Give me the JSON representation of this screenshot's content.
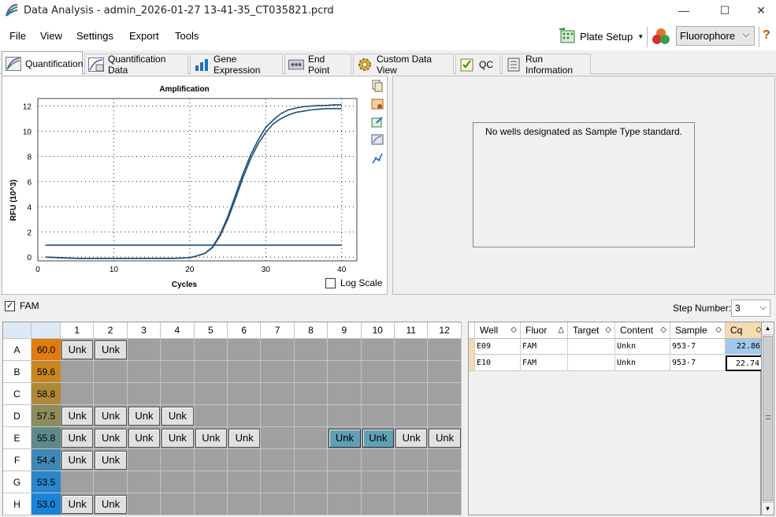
{
  "window": {
    "title": "Data Analysis - admin_2026-01-27 13-41-35_CT035821.pcrd",
    "minimize": "—",
    "maximize": "☐",
    "close": "✕"
  },
  "menu": {
    "file": "File",
    "view": "View",
    "settings": "Settings",
    "export": "Export",
    "tools": "Tools",
    "plate_setup": "Plate Setup",
    "fluorophore": "Fluorophore",
    "help": "?"
  },
  "tabs": [
    "Quantification",
    "Quantification Data",
    "Gene Expression",
    "End Point",
    "Custom Data View",
    "QC",
    "Run Information"
  ],
  "chart": {
    "title": "Amplification",
    "xlabel": "Cycles",
    "ylabel": "RFU (10^3)",
    "log_scale_label": "Log Scale"
  },
  "chart_data": {
    "type": "line",
    "title": "Amplification",
    "xlabel": "Cycles",
    "ylabel": "RFU (10^3)",
    "xlim": [
      0,
      42
    ],
    "ylim": [
      -0.3,
      12.6
    ],
    "xticks": [
      0,
      10,
      20,
      30,
      40
    ],
    "yticks": [
      0,
      2,
      4,
      6,
      8,
      10,
      12
    ],
    "grid": true,
    "series": [
      {
        "color": "#1f4e79",
        "x": [
          1,
          5,
          10,
          15,
          18,
          20,
          21,
          22,
          23,
          24,
          25,
          26,
          27,
          28,
          29,
          30,
          31,
          32,
          33,
          34,
          35,
          36,
          37,
          38,
          39,
          40
        ],
        "y": [
          0.0,
          -0.1,
          -0.1,
          -0.1,
          -0.1,
          -0.05,
          0.1,
          0.3,
          0.8,
          1.8,
          3.2,
          4.9,
          6.6,
          8.1,
          9.3,
          10.3,
          10.9,
          11.4,
          11.7,
          11.85,
          11.95,
          12.0,
          12.05,
          12.05,
          12.1,
          12.1
        ]
      },
      {
        "color": "#1f4e79",
        "x": [
          1,
          5,
          10,
          15,
          18,
          20,
          21,
          22,
          23,
          24,
          25,
          26,
          27,
          28,
          29,
          30,
          31,
          32,
          33,
          34,
          35,
          36,
          37,
          38,
          39,
          40
        ],
        "y": [
          0.0,
          -0.1,
          -0.1,
          -0.1,
          -0.1,
          -0.05,
          0.1,
          0.3,
          0.75,
          1.7,
          3.0,
          4.6,
          6.3,
          7.8,
          9.0,
          9.9,
          10.6,
          11.0,
          11.3,
          11.5,
          11.6,
          11.7,
          11.75,
          11.8,
          11.8,
          11.8
        ]
      },
      {
        "color": "#1f4e79",
        "x": [
          1,
          40
        ],
        "y": [
          0.95,
          0.95
        ]
      }
    ]
  },
  "standard_panel": {
    "message": "No wells designated as Sample Type standard."
  },
  "fluor_filter": {
    "label": "FAM",
    "checked": true
  },
  "step": {
    "label": "Step Number:",
    "value": "3"
  },
  "plate": {
    "columns": [
      "1",
      "2",
      "3",
      "4",
      "5",
      "6",
      "7",
      "8",
      "9",
      "10",
      "11",
      "12"
    ],
    "rows": [
      {
        "label": "A",
        "temp": "60.0",
        "temp_color": "#e07b10",
        "wells": [
          "Unk",
          "Unk",
          "",
          "",
          "",
          "",
          "",
          "",
          "",
          "",
          "",
          ""
        ]
      },
      {
        "label": "B",
        "temp": "59.6",
        "temp_color": "#c8861f",
        "wells": [
          "",
          "",
          "",
          "",
          "",
          "",
          "",
          "",
          "",
          "",
          "",
          ""
        ]
      },
      {
        "label": "C",
        "temp": "58.8",
        "temp_color": "#b0883a",
        "wells": [
          "",
          "",
          "",
          "",
          "",
          "",
          "",
          "",
          "",
          "",
          "",
          ""
        ]
      },
      {
        "label": "D",
        "temp": "57.5",
        "temp_color": "#8c8c5e",
        "wells": [
          "Unk",
          "Unk",
          "Unk",
          "Unk",
          "",
          "",
          "",
          "",
          "",
          "",
          "",
          ""
        ]
      },
      {
        "label": "E",
        "temp": "55.8",
        "temp_color": "#5f8a8a",
        "wells": [
          "Unk",
          "Unk",
          "Unk",
          "Unk",
          "Unk",
          "Unk",
          "",
          "",
          "Unk",
          "Unk",
          "Unk",
          "Unk"
        ]
      },
      {
        "label": "F",
        "temp": "54.4",
        "temp_color": "#3f88b6",
        "wells": [
          "Unk",
          "Unk",
          "",
          "",
          "",
          "",
          "",
          "",
          "",
          "",
          "",
          ""
        ]
      },
      {
        "label": "G",
        "temp": "53.5",
        "temp_color": "#2a86cc",
        "wells": [
          "",
          "",
          "",
          "",
          "",
          "",
          "",
          "",
          "",
          "",
          "",
          ""
        ]
      },
      {
        "label": "H",
        "temp": "53.0",
        "temp_color": "#1a82d8",
        "wells": [
          "Unk",
          "Unk",
          "",
          "",
          "",
          "",
          "",
          "",
          "",
          "",
          "",
          ""
        ]
      }
    ],
    "selected_wells": [
      "E9",
      "E10"
    ]
  },
  "results": {
    "headers": [
      "Well",
      "Fluor",
      "Target",
      "Content",
      "Sample",
      "Cq"
    ],
    "rows": [
      {
        "well": "E09",
        "fluor": "FAM",
        "target": "",
        "content": "Unkn",
        "sample": "953-7",
        "cq": "22.86"
      },
      {
        "well": "E10",
        "fluor": "FAM",
        "target": "",
        "content": "Unkn",
        "sample": "953-7",
        "cq": "22.74"
      }
    ]
  }
}
